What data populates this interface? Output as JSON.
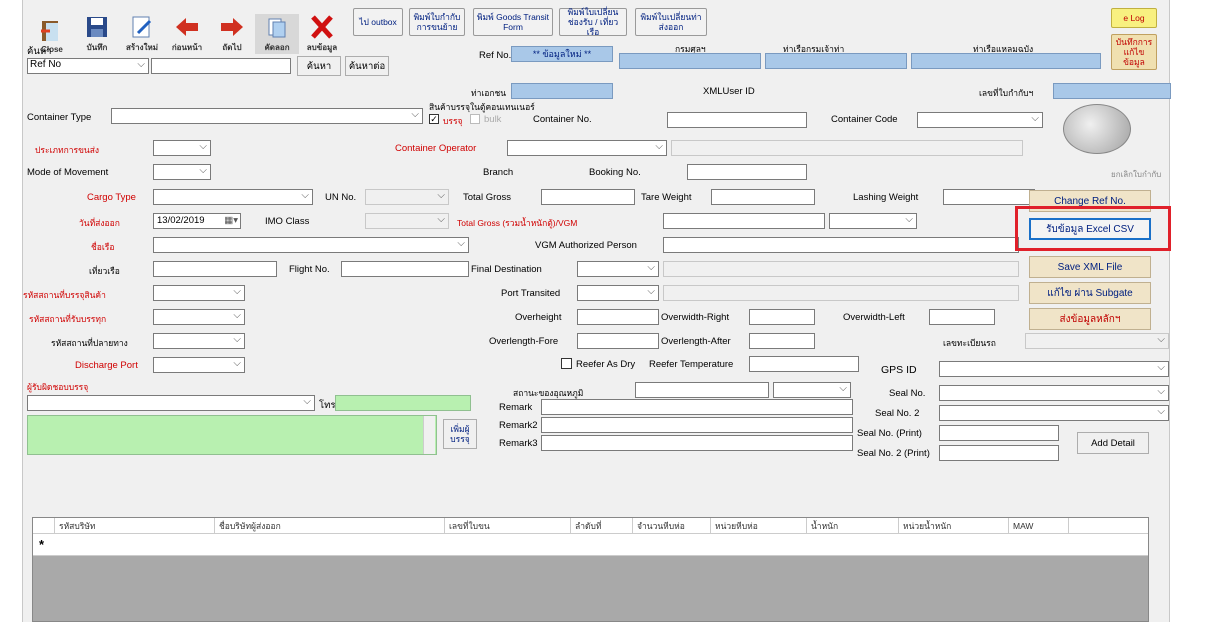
{
  "toolbar": {
    "close": "Close",
    "save": "บันทึก",
    "new": "สร้างใหม่",
    "prev": "ก่อนหน้า",
    "next": "ถัดไป",
    "copy": "คัดลอก",
    "delete": "ลบข้อมูล"
  },
  "top_buttons": {
    "outbox": "ไป outbox",
    "print_receipt": "พิมพ์ใบกำกับการขนย้าย",
    "print_goods_transit": "พิมพ์ Goods Transit Form",
    "print_change1": "พิมพ์ใบเปลี่ยนช่องรับ / เที่ยวเรือ",
    "print_change2": "พิมพ์ใบเปลี่ยนท่าส่งออก",
    "log": "e Log",
    "save_edit": "บันทึกการแก้ไขข้อมูล"
  },
  "search": {
    "label": "ค้นหา",
    "field_value": "Ref No",
    "find": "ค้นหา",
    "advanced": "ค้นหาต่อ"
  },
  "ref": {
    "label": "Ref No.",
    "value": "** ข้อมูลใหม่ **",
    "customs_label": "กรมศุลฯ",
    "port_auth_label": "ท่าเรือกรมเจ้าท่า",
    "dept_label": "ท่าเรือแหลมฉบัง",
    "port_label": "ท่าเอกชน",
    "xml_user_label": "XMLUser ID",
    "doc_no_label": "เลขที่ใบกำกับฯ"
  },
  "container": {
    "type_label": "Container Type",
    "cargo_header": "สินค้าบรรจุในตู้คอนเทนเนอร์",
    "packed": "บรรจุ",
    "bulk": "bulk",
    "no_label": "Container No.",
    "code_label": "Container Code",
    "operator_label": "Container Operator"
  },
  "fields": {
    "shipping_type": "ประเภทการขนส่ง",
    "mode": "Mode of Movement",
    "branch": "Branch",
    "booking": "Booking No.",
    "cargo_type": "Cargo Type",
    "un_no": "UN No.",
    "total_gross": "Total Gross",
    "tare": "Tare Weight",
    "lashing": "Lashing Weight",
    "load_date": "วันที่ส่งออก",
    "date_value": "13/02/2019",
    "imo": "IMO Class",
    "vgm": "Total Gross (รวมน้ำหนักตู้)/VGM",
    "ship_name": "ชื่อเรือ",
    "vgm_person": "VGM Authorized Person",
    "voyage": "เที่ยวเรือ",
    "flight": "Flight No.",
    "final_dest": "Final Destination",
    "port_load": "รหัสสถานที่บรรจุสินค้า",
    "port_transited": "Port Transited",
    "origin": "รหัสสถานที่รับบรรทุก",
    "over_height": "Overheight",
    "over_right": "Overwidth-Right",
    "over_left": "Overwidth-Left",
    "dest_code": "รหัสสถานที่ปลายทาง",
    "over_fore": "Overlength-Fore",
    "over_after": "Overlength-After",
    "export_no": "เลขทะเบียนรถ",
    "discharge": "Discharge Port",
    "reefer_dry": "Reefer As Dry",
    "reefer_temp": "Reefer Temperature",
    "gps": "GPS ID",
    "carrier": "ผู้รับผิดชอบบรรจุ",
    "temp_label": "สถานะของอุณหภูมิ",
    "seal": "Seal No.",
    "tel": "โทร",
    "remark": "Remark",
    "seal2": "Seal No. 2",
    "add_box": "เพิ่มผู้บรรจุ",
    "remark2": "Remark2",
    "seal_print": "Seal No. (Print)",
    "remark3": "Remark3",
    "seal2_print": "Seal No. 2 (Print)",
    "add_detail": "Add Detail"
  },
  "right_panel": {
    "cancel_doc": "ยกเลิกใบกำกับ",
    "change_ref": "Change Ref No.",
    "import_csv": "รับข้อมูล Excel CSV",
    "save_xml": "Save XML File",
    "edit_subgate": "แก้ไข ผ่าน Subgate",
    "send": "ส่งข้อมูลหลักฯ"
  },
  "grid": {
    "columns": [
      "รหัสบริษัท",
      "ชื่อบริษัทผู้ส่งออก",
      "เลขที่ใบขน",
      "ลำดับที่",
      "จำนวนหีบห่อ",
      "หน่วยหีบห่อ",
      "น้ำหนัก",
      "หน่วยน้ำหนัก",
      "MAW"
    ],
    "new_row_marker": "*"
  },
  "colors": {
    "highlight": "#e0202a",
    "blue_field": "#a9c8e8",
    "green_field": "#b8f0b0",
    "right_btn": "#f0e4c8"
  }
}
